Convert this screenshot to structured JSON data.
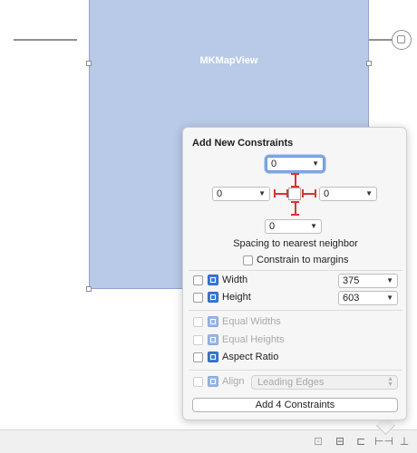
{
  "canvas": {
    "view_label": "MKMapView"
  },
  "popover": {
    "title": "Add New Constraints",
    "spacing": {
      "top": "0",
      "left": "0",
      "right": "0",
      "bottom": "0"
    },
    "spacing_caption": "Spacing to nearest neighbor",
    "constrain_to_margins": {
      "label": "Constrain to margins",
      "checked": false
    },
    "size_rows": [
      {
        "label": "Width",
        "value": "375",
        "checked": false
      },
      {
        "label": "Height",
        "value": "603",
        "checked": false
      }
    ],
    "equal_rows": [
      {
        "label": "Equal Widths",
        "enabled": false
      },
      {
        "label": "Equal Heights",
        "enabled": false
      },
      {
        "label": "Aspect Ratio",
        "enabled": true
      }
    ],
    "align": {
      "label": "Align",
      "value": "Leading Edges",
      "enabled": false
    },
    "add_button": "Add 4 Constraints"
  },
  "colors": {
    "accent": "#3d7bd6",
    "constraint": "#d9342b",
    "view_fill": "#b8cae8"
  },
  "icons": [
    "arrow-right-icon",
    "exit-icon",
    "update-frames-icon",
    "stack-icon",
    "align-icon",
    "pin-icon",
    "resolve-icon"
  ]
}
